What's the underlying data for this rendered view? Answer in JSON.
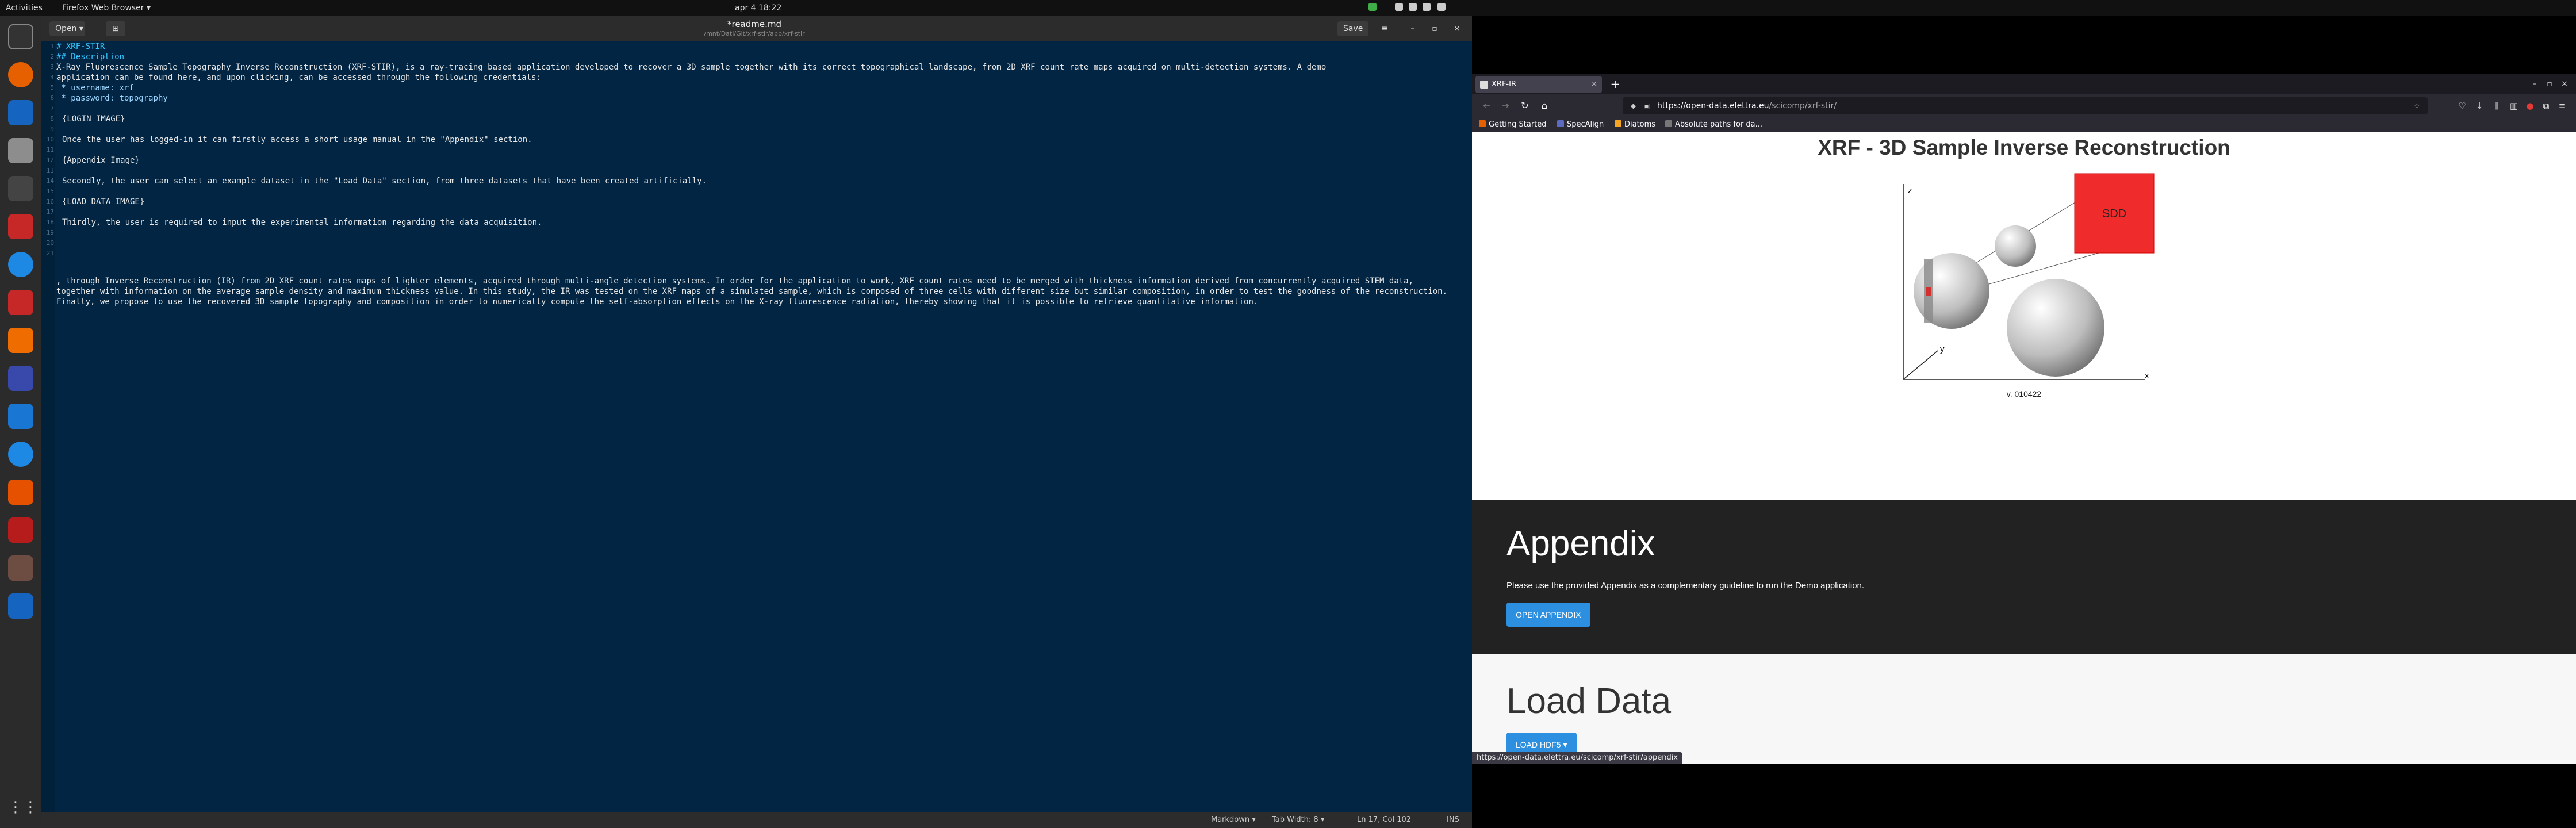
{
  "topbar": {
    "activities": "Activities",
    "app_menu": "Firefox Web Browser ▾",
    "clock": "apr 4  18:22"
  },
  "editor": {
    "open_label": "Open",
    "save_label": "Save",
    "title": "*readme.md",
    "subtitle": "/mnt/Dati/Git/xrf-stir/app/xrf-stir",
    "line_numbers": [
      "1",
      "2",
      "3",
      "4",
      "5",
      "6",
      "7",
      "8",
      "9",
      "10",
      "11",
      "12",
      "13",
      "14",
      "15",
      "16",
      "17",
      "18",
      "19",
      "20",
      "21"
    ],
    "lines": [
      "# XRF-STIR",
      "## Description",
      "X-Ray Fluorescence Sample Topography Inverse Reconstruction (XRF-STIR), is a ray-tracing based application developed to recover a 3D sample together with its correct topographical landscape, from 2D XRF count rate maps acquired on multi-detection systems. A demo",
      "application can be found here, and upon clicking, can be accessed through the following credentials:",
      " * username: xrf",
      " * password: topography",
      "",
      "{LOGIN IMAGE}",
      "",
      "Once the user has logged-in it can firstly access a short usage manual in the \"Appendix\" section.",
      "",
      "{Appendix Image}",
      "",
      "Secondly, the user can select an example dataset in the \"Load Data\" section, from three datasets that have been created artificially.",
      "",
      "{LOAD DATA IMAGE}",
      "",
      "Thirdly, the user is required to input the experimental information regarding the data acquisition.",
      ", through Inverse Reconstruction (IR) from 2D XRF count rates maps of lighter elements, acquired through multi-angle detection systems. In order for the application to work, XRF count rates need to be merged with thickness information derived from concurrently acquired STEM data, together with information on the average sample density and maximum thickness value. In this study, the IR was tested on the XRF maps of a simulated sample, which is composed of three cells with different size but similar composition, in order to test the goodness of the reconstruction. Finally, we propose to use the recovered 3D sample topography and composition in order to numerically compute the self-absorption effects on the X-ray fluorescence radiation, thereby showing that it is possible to retrieve quantitative information."
    ],
    "status": {
      "language": "Markdown ▾",
      "tab_width": "Tab Width: 8 ▾",
      "position": "Ln 17, Col 102",
      "mode": "INS"
    }
  },
  "firefox": {
    "tab_title": "XRF-IR",
    "url_host": "https://open-data.elettra.eu",
    "url_path": "/scicomp/xrf-stir/",
    "bookmarks": [
      "Getting Started",
      "SpecAlign",
      "Diatoms",
      "Absolute paths for da..."
    ],
    "status_url": "https://open-data.elettra.eu/scicomp/xrf-stir/appendix"
  },
  "page": {
    "title": "XRF - 3D Sample Inverse Reconstruction",
    "figure": {
      "detector": "SDD",
      "axis_z": "z",
      "axis_x": "x",
      "axis_y": "y",
      "version": "v. 010422"
    },
    "appendix": {
      "heading": "Appendix",
      "text": "Please use the provided Appendix as a complementary guideline to run the Demo application.",
      "button": "OPEN APPENDIX"
    },
    "load": {
      "heading": "Load Data",
      "button": "LOAD HDF5 ▾"
    }
  },
  "colors": {
    "editor_bg": "#012542",
    "heading": "#36c6ff",
    "sdd": "#ef2b2b",
    "button": "#2d8fe0"
  }
}
